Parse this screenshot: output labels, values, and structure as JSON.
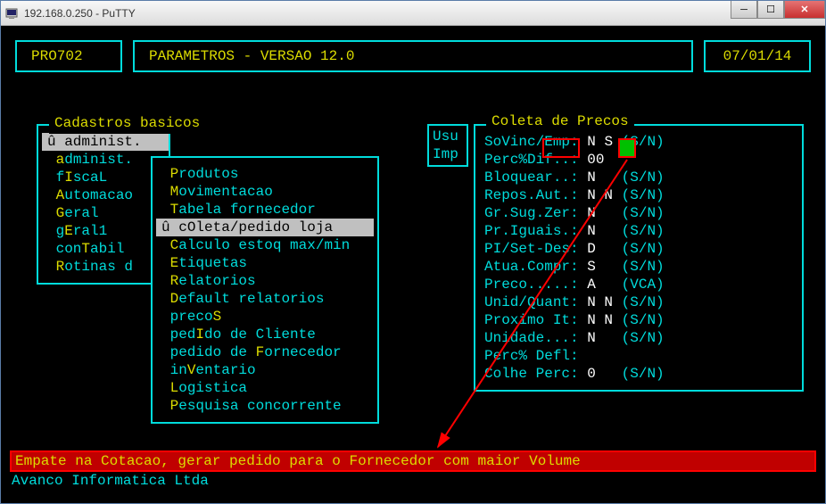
{
  "window": {
    "title": "192.168.0.250 - PuTTY"
  },
  "header": {
    "code": "PRO702",
    "params": "PARAMETROS - VERSAO 12.0",
    "date": "07/01/14"
  },
  "menu1": {
    "title": "Cadastros basicos",
    "items": [
      {
        "prefix": "û ",
        "label": "administ.",
        "hot": ""
      },
      {
        "prefix": "  a",
        "label": "dminist.",
        "hot": "a"
      },
      {
        "prefix": "  f",
        "label": "scaL",
        "hot": "I"
      },
      {
        "prefix": "  ",
        "label": "utomacao",
        "hot": "A"
      },
      {
        "prefix": "  ",
        "label": "eral",
        "hot": "G"
      },
      {
        "prefix": "  g",
        "label": "ral1",
        "hot": "E"
      },
      {
        "prefix": "  con",
        "label": "abil",
        "hot": "T"
      },
      {
        "prefix": "  ",
        "label": "otinas d",
        "hot": "R"
      }
    ]
  },
  "menu2": {
    "items": [
      {
        "pre": "",
        "hot": "P",
        "post": "rodutos"
      },
      {
        "pre": "",
        "hot": "M",
        "post": "ovimentacao"
      },
      {
        "pre": "",
        "hot": "T",
        "post": "abela fornecedor"
      },
      {
        "pre": "û c",
        "hot": "O",
        "post": "leta/pedido loja"
      },
      {
        "pre": "",
        "hot": "C",
        "post": "alculo estoq max/min"
      },
      {
        "pre": "",
        "hot": "E",
        "post": "tiquetas"
      },
      {
        "pre": "",
        "hot": "R",
        "post": "elatorios"
      },
      {
        "pre": "",
        "hot": "D",
        "post": "efault relatorios"
      },
      {
        "pre": "preco",
        "hot": "S",
        "post": ""
      },
      {
        "pre": "ped",
        "hot": "I",
        "post": "do de Cliente"
      },
      {
        "pre": "pedido de ",
        "hot": "F",
        "post": "ornecedor"
      },
      {
        "pre": "in",
        "hot": "V",
        "post": "entario"
      },
      {
        "pre": "",
        "hot": "L",
        "post": "ogistica"
      },
      {
        "pre": "",
        "hot": "P",
        "post": "esquisa concorrente"
      }
    ]
  },
  "impbox": {
    "line1": "Usu",
    "line2": "Imp"
  },
  "panel": {
    "title": "Coleta de Precos",
    "rows": [
      {
        "label": "SoVinc/",
        "label2": "Emp",
        "label3": ": ",
        "val": "N ",
        "val2": "S",
        "opt": " (S/N)"
      },
      {
        "label": "Perc%Dif..: ",
        "val": "00",
        "opt": ""
      },
      {
        "label": "Bloquear..: ",
        "val": "N",
        "opt": "   (S/N)"
      },
      {
        "label": "Repos.Aut.: ",
        "val": "N N",
        "opt": " (S/N)"
      },
      {
        "label": "Gr.Sug.Zer: ",
        "val": "N",
        "opt": "   (S/N)"
      },
      {
        "label": "Pr.Iguais.: ",
        "val": "N",
        "opt": "   (S/N)"
      },
      {
        "label": "PI/Set-Des: ",
        "val": "D",
        "opt": "   (S/N)"
      },
      {
        "label": "Atua.Compr: ",
        "val": "S",
        "opt": "   (S/N)"
      },
      {
        "label": "Preco.....: ",
        "val": "A",
        "opt": "   (VCA)"
      },
      {
        "label": "Unid/Quant: ",
        "val": "N N",
        "opt": " (S/N)"
      },
      {
        "label": "Proximo It: ",
        "val": "N N",
        "opt": " (S/N)"
      },
      {
        "label": "Unidade...: ",
        "val": "N",
        "opt": "   (S/N)"
      },
      {
        "label": "Perc% Defl:",
        "val": "",
        "opt": ""
      },
      {
        "label": "Colhe Perc: ",
        "val": "0",
        "opt": "   (S/N)"
      }
    ]
  },
  "message": "Empate na Cotacao, gerar pedido para o Fornecedor com maior Volume",
  "footer": "Avanco Informatica Ltda"
}
